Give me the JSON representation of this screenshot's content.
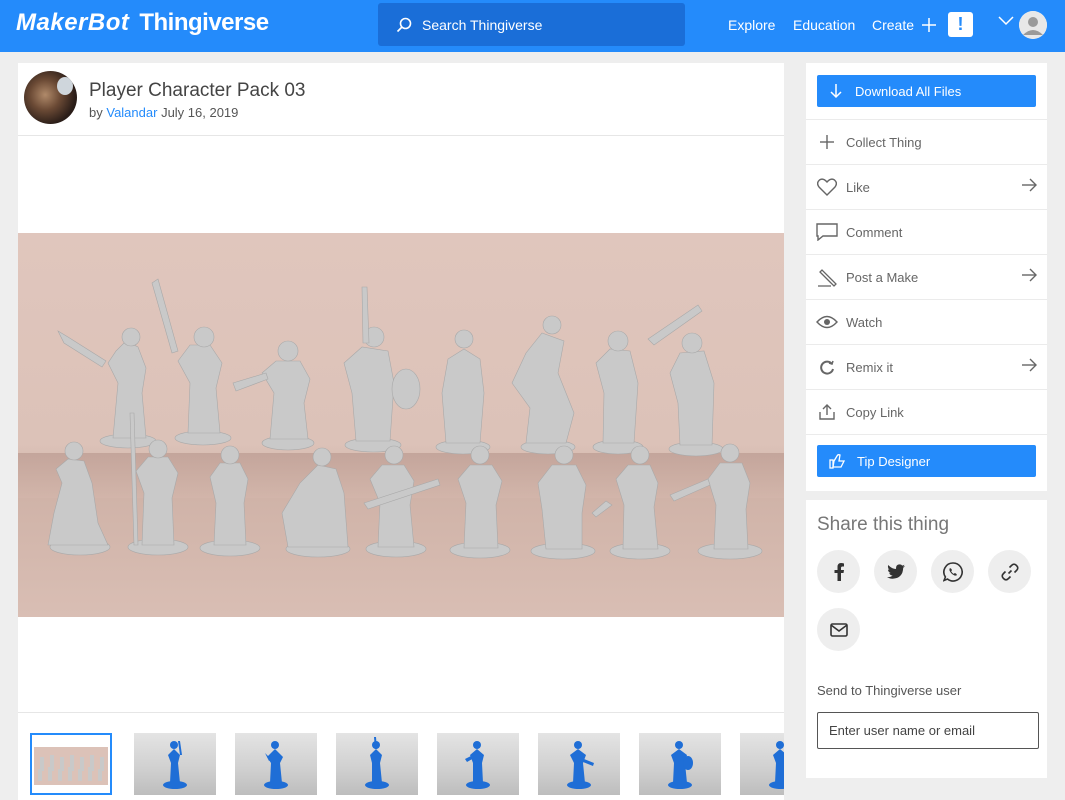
{
  "header": {
    "logo_maker": "MakerBot",
    "logo_thing": "Thingiverse",
    "search_placeholder": "Search Thingiverse",
    "nav_explore": "Explore",
    "nav_education": "Education",
    "nav_create": "Create",
    "alert_label": "!"
  },
  "thing": {
    "title": "Player Character Pack 03",
    "by": "by",
    "author": "Valandar",
    "date": "July 16, 2019"
  },
  "actions": {
    "download_label": "Download All Files",
    "collect_label": "Collect Thing",
    "like_label": "Like",
    "comment_label": "Comment",
    "make_label": "Post a Make",
    "watch_label": "Watch",
    "remix_label": "Remix it",
    "copy_label": "Copy Link",
    "tip_label": "Tip Designer"
  },
  "share": {
    "title": "Share this thing",
    "send_label": "Send to Thingiverse user",
    "send_placeholder": "Enter user name or email"
  },
  "colors": {
    "brand_blue": "#248bfb",
    "search_blue": "#1a6ed8",
    "figure_grey": "#c9c9c9",
    "thumb_figure_blue": "#1f6ed6"
  }
}
